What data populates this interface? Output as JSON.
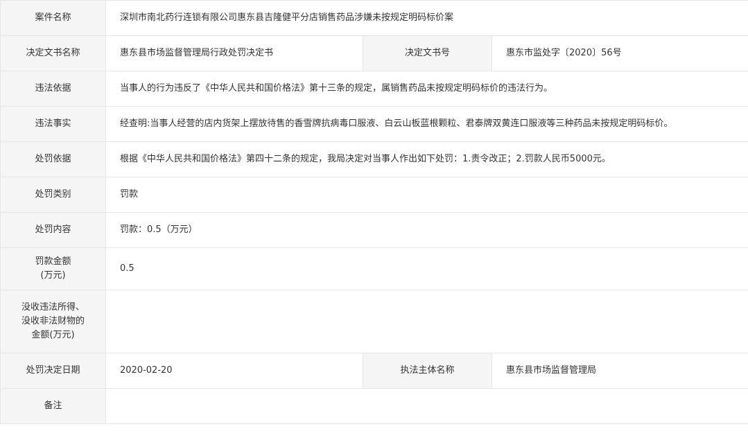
{
  "case_name": {
    "label": "案件名称",
    "value": "深圳市南北药行连锁有限公司惠东县吉隆健平分店销售药品涉嫌未按规定明码标价案"
  },
  "doc_name": {
    "label": "决定文书名称",
    "value": "惠东县市场监督管理局行政处罚决定书"
  },
  "doc_number": {
    "label": "决定文书号",
    "value": "惠东市监处字〔2020〕56号"
  },
  "violation_basis": {
    "label": "违法依据",
    "value": "当事人的行为违反了《中华人民共和国价格法》第十三条的规定，属销售药品未按规定明码标价的违法行为。"
  },
  "violation_facts": {
    "label": "违法事实",
    "value": "经查明:当事人经营的店内货架上摆放待售的香雪牌抗病毒口服液、白云山板蓝根颗粒、君泰牌双黄连口服液等三种药品未按规定明码标价。"
  },
  "penalty_basis": {
    "label": "处罚依据",
    "value": "根据《中华人民共和国价格法》第四十二条的规定，我局决定对当事人作出如下处罚：1.责令改正；2.罚款人民币5000元。"
  },
  "penalty_type": {
    "label": "处罚类别",
    "value": "罚款"
  },
  "penalty_content": {
    "label": "处罚内容",
    "value": "罚款：0.5（万元）"
  },
  "fine_amount": {
    "label_line1": "罚款金额",
    "label_line2": "(万元)",
    "value": "0.5"
  },
  "confiscation": {
    "label_line1": "没收违法所得、",
    "label_line2": "没收非法财物的",
    "label_line3": "金额(万元)",
    "value": ""
  },
  "decision_date": {
    "label": "处罚决定日期",
    "value": "2020-02-20"
  },
  "enforcement_body": {
    "label": "执法主体名称",
    "value": "惠东县市场监督管理局"
  },
  "remarks": {
    "label": "备注",
    "value": ""
  }
}
